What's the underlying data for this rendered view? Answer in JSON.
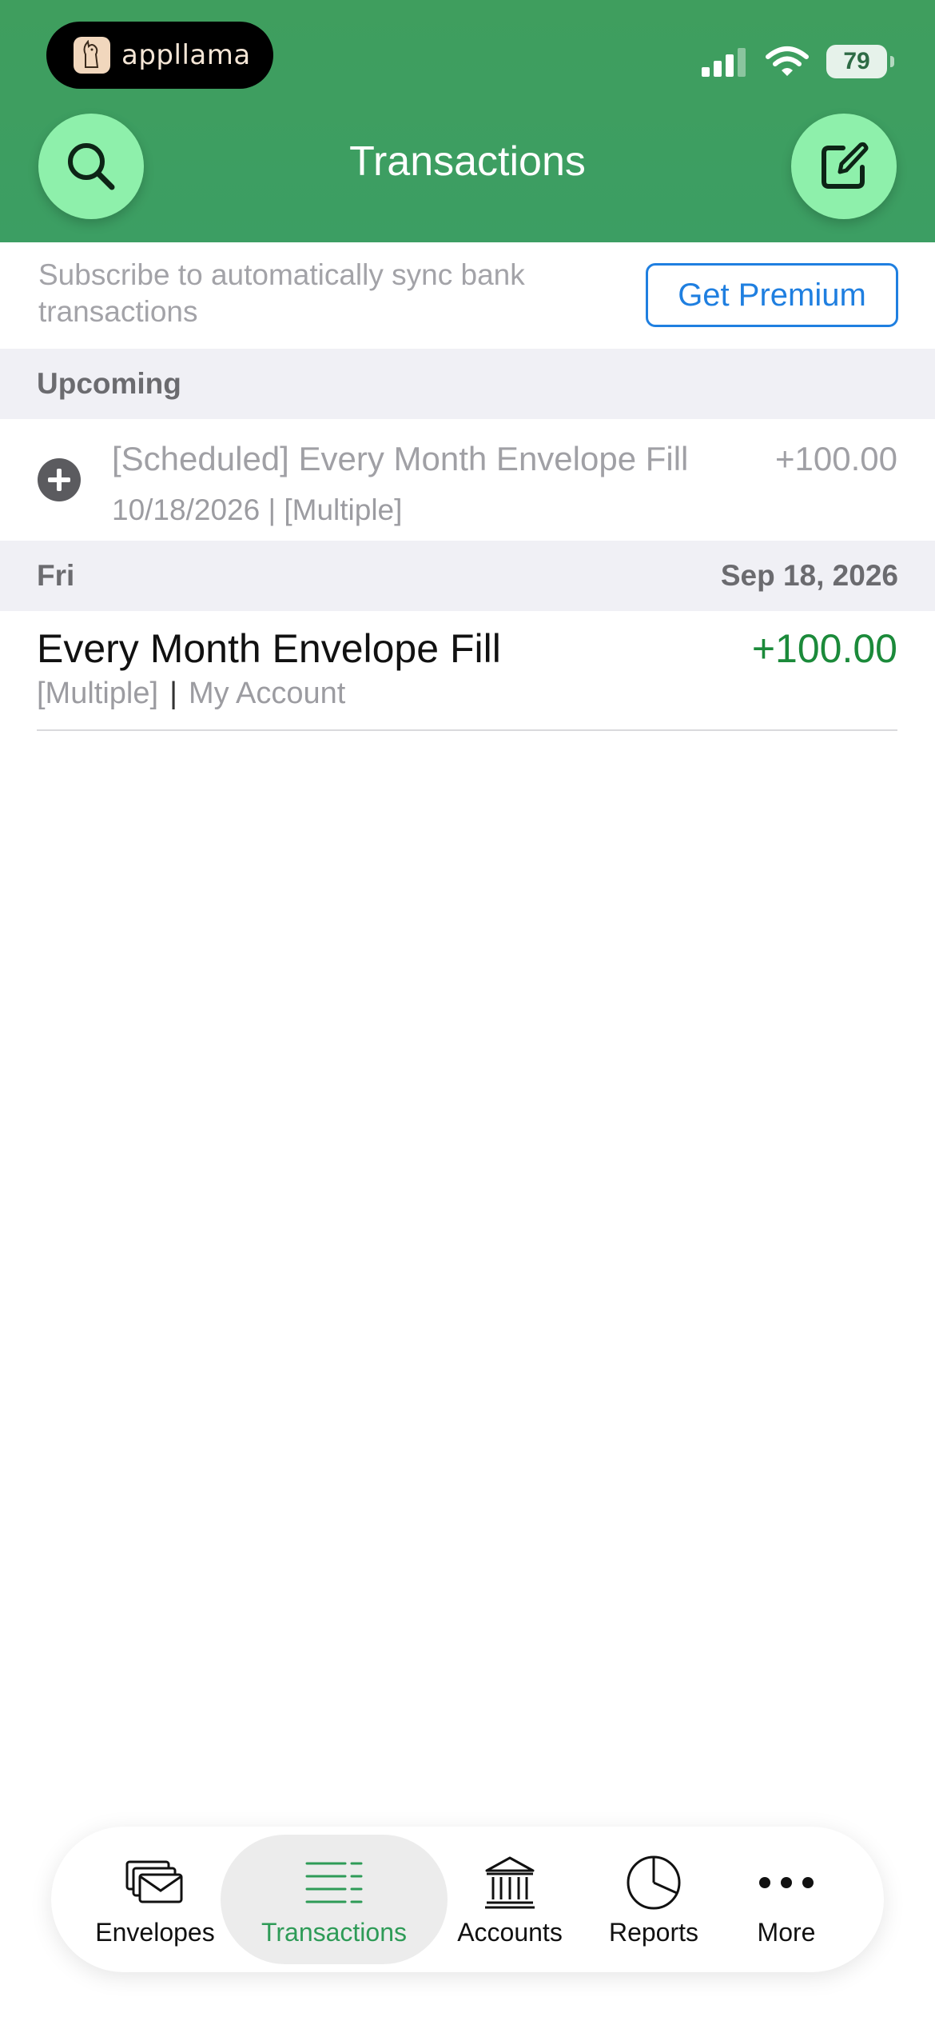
{
  "status_bar": {
    "brand": "appllama",
    "battery": "79"
  },
  "header": {
    "title": "Transactions"
  },
  "promo": {
    "message": "Subscribe to automatically sync bank transactions",
    "button": "Get Premium"
  },
  "upcoming": {
    "section_label": "Upcoming",
    "item": {
      "name": "[Scheduled] Every Month Envelope Fill",
      "amount": "+100.00",
      "details": "10/18/2026 | [Multiple]"
    }
  },
  "day_group": {
    "weekday": "Fri",
    "date": "Sep 18, 2026",
    "transactions": [
      {
        "name": "Every Month Envelope Fill",
        "amount": "+100.00",
        "envelope": "[Multiple]",
        "separator": "|",
        "account": "My Account"
      }
    ]
  },
  "tabbar": {
    "tabs": [
      {
        "label": "Envelopes",
        "icon": "envelopes-icon"
      },
      {
        "label": "Transactions",
        "icon": "transactions-list-icon",
        "active": true
      },
      {
        "label": "Accounts",
        "icon": "bank-icon"
      },
      {
        "label": "Reports",
        "icon": "pie-chart-icon"
      },
      {
        "label": "More",
        "icon": "more-dots-icon"
      }
    ]
  },
  "colors": {
    "header_green": "#3f9e5e",
    "button_mint": "#8ef0ab",
    "income_green": "#1b8a3a",
    "link_blue": "#1f7fe0",
    "active_tab": "#2e9b57"
  }
}
